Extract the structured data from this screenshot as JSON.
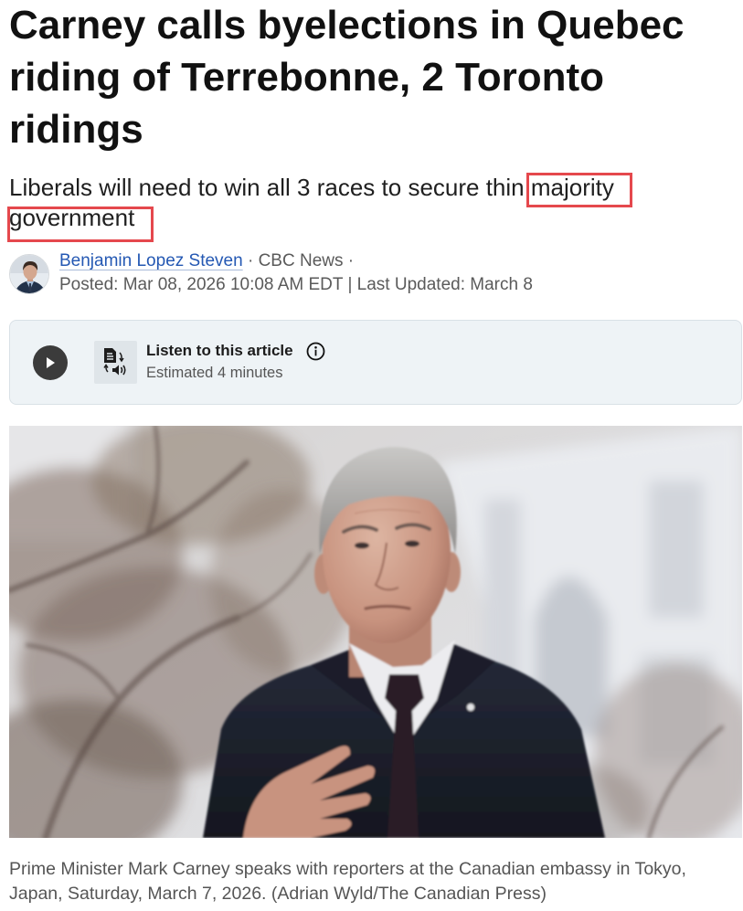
{
  "article": {
    "headline": "Carney calls byelections in Quebec riding of Terrebonne, 2 Toronto ridings",
    "subtitle": {
      "lead": "Liberals will need to win all 3 races to secure thin",
      "highlight_1": "majority",
      "highlight_2": "government"
    },
    "byline": {
      "author": "Benjamin Lopez Steven",
      "sep_1": "·",
      "outlet": "CBC News",
      "sep_2": "·",
      "posted": "Posted: Mar 08, 2026 10:08 AM EDT",
      "divider": "|",
      "updated": "Last Updated: March 8"
    },
    "audio": {
      "title": "Listen to this article",
      "duration": "Estimated 4 minutes"
    },
    "photo": {
      "caption": "Prime Minister Mark Carney speaks with reporters at the Canadian embassy in Tokyo, Japan, Saturday, March 7, 2026. (Adrian Wyld/The Canadian Press)"
    }
  },
  "icons": {
    "play": "play-icon",
    "listen": "document-audio-icon",
    "info": "info-icon",
    "author_avatar": "author-avatar"
  },
  "colors": {
    "headline": "#111111",
    "subtitle_text": "#1f1f1f",
    "author_link": "#2458b3",
    "author_underline": "#a9bbd9",
    "meta_text": "#5a5a5a",
    "audio_panel_bg": "#eef3f6",
    "audio_panel_border": "#d9e1e6",
    "play_button": "#3b3b3b",
    "icon_tile_bg": "#dfe5e9",
    "highlight_box": "#e5484d",
    "caption_text": "#555555"
  }
}
